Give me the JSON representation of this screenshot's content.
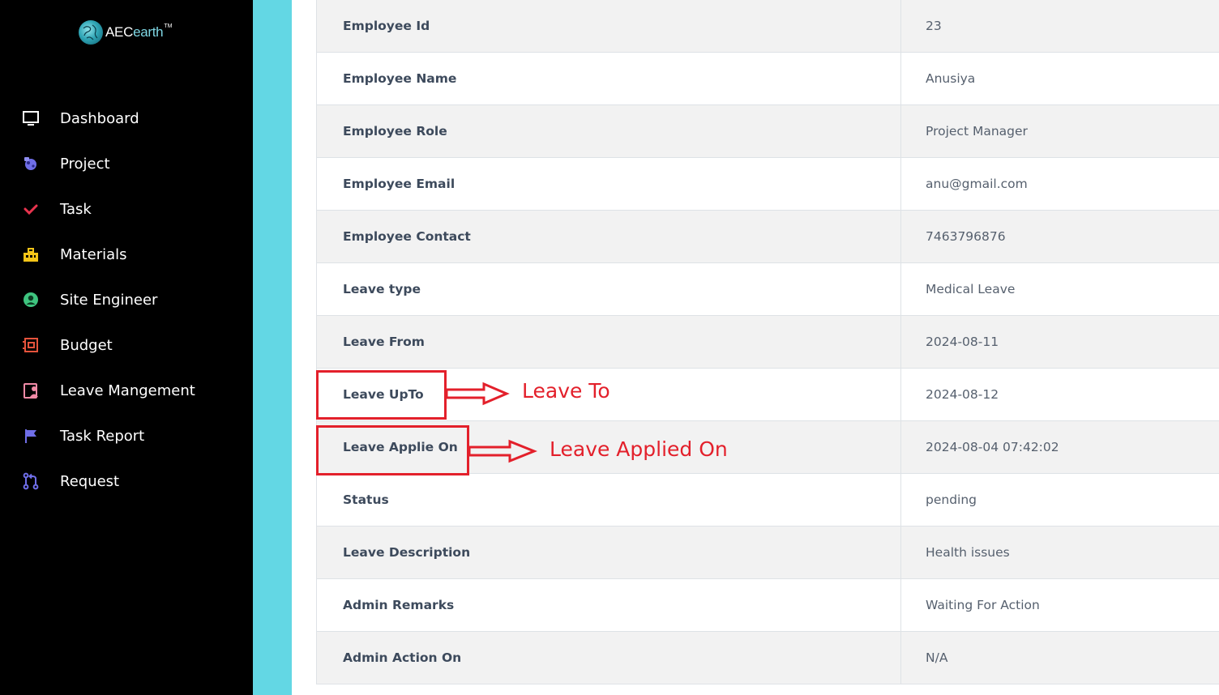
{
  "brand": {
    "logo_main": "AEC",
    "logo_accent": "earth",
    "logo_tm": "TM"
  },
  "sidebar": {
    "items": [
      {
        "label": "Dashboard",
        "icon": "monitor-icon",
        "color": "#ffffff"
      },
      {
        "label": "Project",
        "icon": "project-icon",
        "color": "#6f6ee8"
      },
      {
        "label": "Task",
        "icon": "check-icon",
        "color": "#e8344e"
      },
      {
        "label": "Materials",
        "icon": "materials-icon",
        "color": "#f5c518"
      },
      {
        "label": "Site Engineer",
        "icon": "user-circle-icon",
        "color": "#3ec47f"
      },
      {
        "label": "Budget",
        "icon": "budget-icon",
        "color": "#e5533c"
      },
      {
        "label": "Leave Mangement",
        "icon": "leave-icon",
        "color": "#f08aa6"
      },
      {
        "label": "Task Report",
        "icon": "flag-icon",
        "color": "#6f6ee8"
      },
      {
        "label": "Request",
        "icon": "pull-request-icon",
        "color": "#6f6ee8"
      }
    ]
  },
  "details": {
    "rows": [
      {
        "label": "Employee Id",
        "value": "23"
      },
      {
        "label": "Employee Name",
        "value": "Anusiya"
      },
      {
        "label": "Employee Role",
        "value": "Project Manager"
      },
      {
        "label": "Employee Email",
        "value": "anu@gmail.com"
      },
      {
        "label": "Employee Contact",
        "value": "7463796876"
      },
      {
        "label": "Leave type",
        "value": "Medical Leave"
      },
      {
        "label": "Leave From",
        "value": "2024-08-11"
      },
      {
        "label": "Leave UpTo",
        "value": "2024-08-12"
      },
      {
        "label": "Leave Applie On",
        "value": "2024-08-04 07:42:02"
      },
      {
        "label": "Status",
        "value": "pending"
      },
      {
        "label": "Leave Description",
        "value": "Health issues"
      },
      {
        "label": "Admin Remarks",
        "value": "Waiting For Action"
      },
      {
        "label": "Admin Action On",
        "value": "N/A"
      }
    ]
  },
  "annotations": {
    "leave_to": "Leave To",
    "leave_applied_on": "Leave Applied On",
    "color": "#e3202b"
  },
  "colors": {
    "sidebar_bg": "#000000",
    "strip": "#63d7e4",
    "row_alt": "#f2f2f2"
  }
}
